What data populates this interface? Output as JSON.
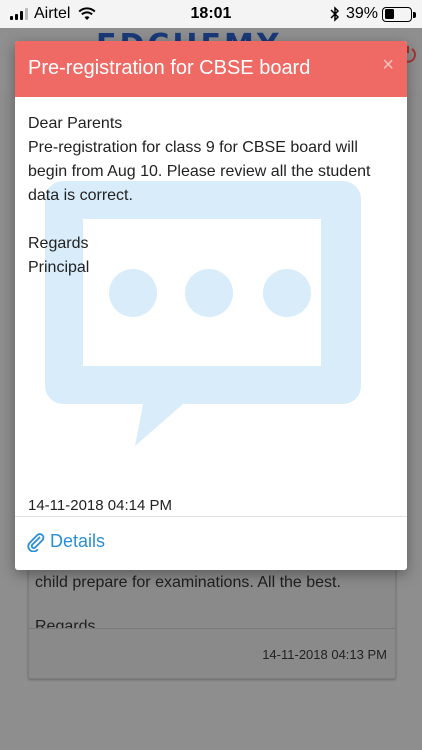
{
  "status_bar": {
    "carrier": "Airtel",
    "time": "18:01",
    "battery_percent": "39%"
  },
  "background": {
    "logo_text": "EDCHEMY",
    "card_text": "child prepare for examinations. All the best.",
    "card_regards": "Regards",
    "card_date": "14-11-2018 04:13 PM"
  },
  "modal": {
    "title": "Pre-registration for CBSE board",
    "close_label": "×",
    "greeting": "Dear Parents",
    "message": "Pre-registration for class 9 for CBSE board will begin from Aug 10. Please review all the student data is correct.",
    "regards": "Regards",
    "signature": "Principal",
    "date": "14-11-2018 04:14 PM",
    "details_label": "Details"
  },
  "colors": {
    "header": "#ef6a64",
    "link": "#2b8fd3",
    "watermark": "#d8ecf9"
  },
  "icons": [
    "wifi-icon",
    "bluetooth-icon",
    "battery-icon",
    "power-icon",
    "close-icon",
    "paperclip-icon",
    "chat-bubble-watermark-icon"
  ]
}
